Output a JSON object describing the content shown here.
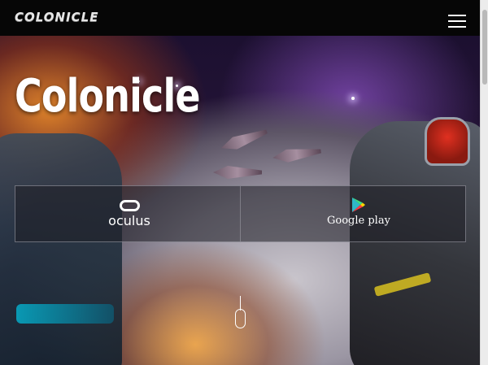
{
  "navbar": {
    "brand": "COLONICLE",
    "menu_icon": "hamburger-menu-icon"
  },
  "hero": {
    "title": "Colonicle",
    "stores": [
      {
        "label": "oculus",
        "icon": "oculus-logo-icon"
      },
      {
        "label": "Google play",
        "icon": "google-play-icon"
      }
    ],
    "scroll_icon": "scroll-down-mouse-icon"
  },
  "colors": {
    "navbar_bg": "#060606",
    "title": "#ffffff",
    "store_bar_border": "#c8c8d2",
    "google_play_teal": "#2fb8c8",
    "google_play_green": "#3ddc84",
    "google_play_yellow": "#ffd400",
    "google_play_red": "#ff3a44"
  }
}
